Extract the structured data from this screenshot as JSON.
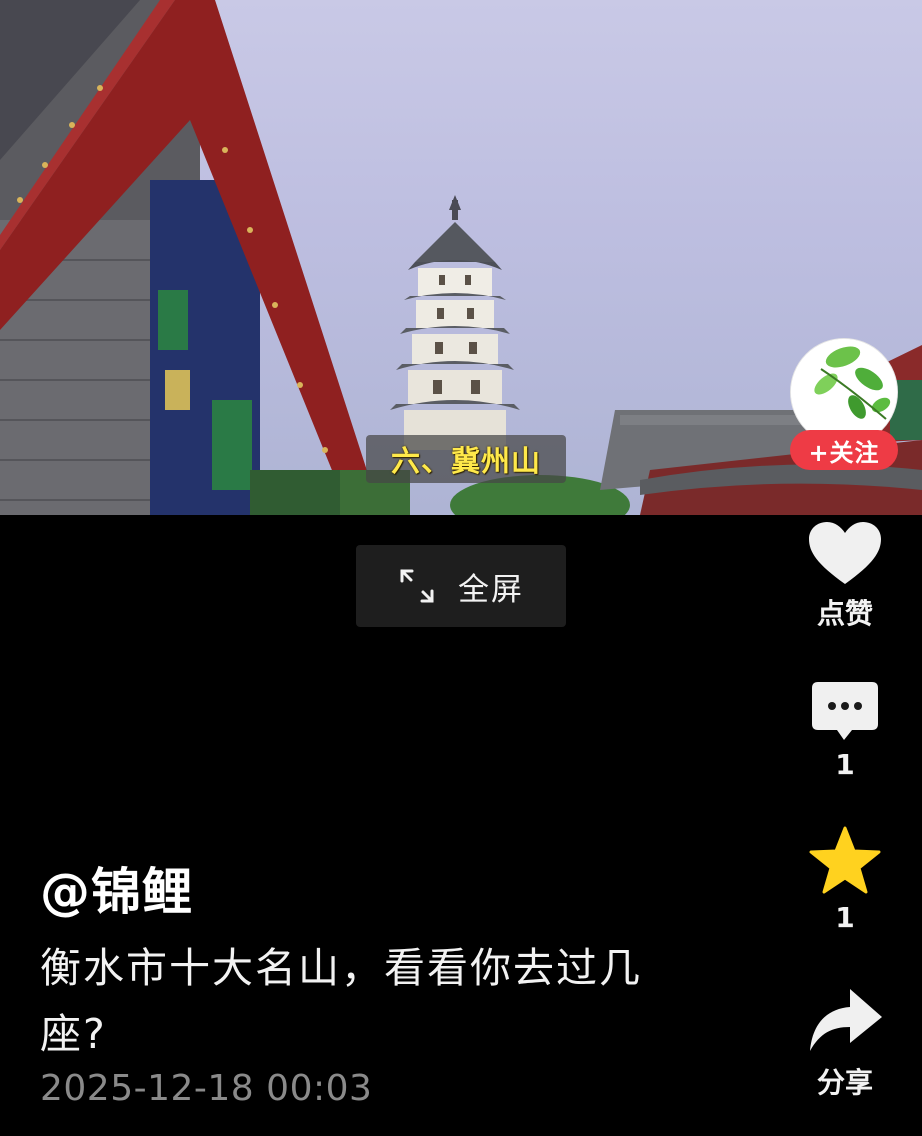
{
  "video": {
    "subtitle": "六、冀州山"
  },
  "fullscreen": {
    "icon": "expand-arrows-icon",
    "label": "全屏"
  },
  "author": {
    "avatar_icon": "green-leaves-avatar",
    "follow_label": "+关注",
    "handle": "@锦鲤"
  },
  "actions": {
    "like": {
      "icon": "heart-icon",
      "label": "点赞"
    },
    "comment": {
      "icon": "comment-bubble-icon",
      "count": "1"
    },
    "favorite": {
      "icon": "star-icon",
      "count": "1"
    },
    "share": {
      "icon": "share-arrow-icon",
      "label": "分享"
    }
  },
  "post": {
    "caption": "衡水市十大名山，看看你去过几座?",
    "timestamp": "2025-12-18 00:03"
  },
  "colors": {
    "follow_button": "#ee3b45",
    "star": "#ffd21f",
    "subtitle_text": "#ffe94a",
    "background": "#000000"
  }
}
